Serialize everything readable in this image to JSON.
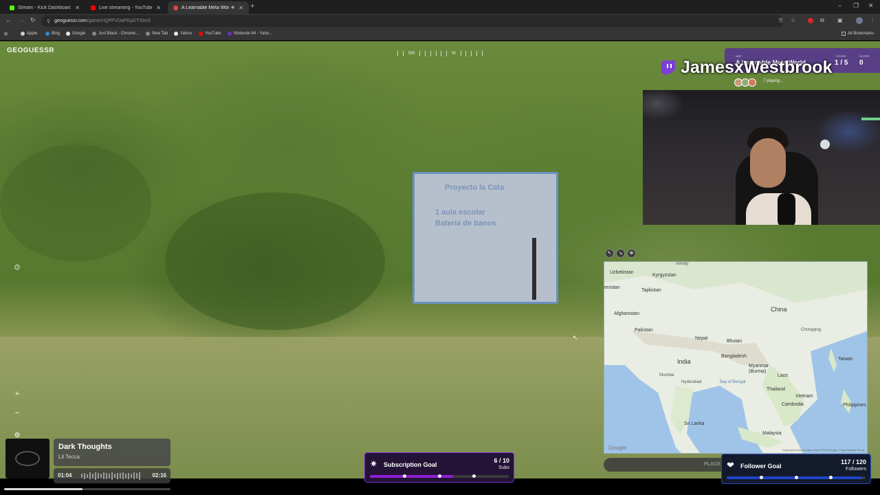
{
  "tabs": [
    {
      "label": "Stream - Kick Dashboard",
      "color": "#53fc18"
    },
    {
      "label": "Live streaming - YouTube Studi",
      "color": "#ff0000"
    },
    {
      "label": "A Learnable Meta World - F",
      "color": "#e04646"
    }
  ],
  "address": {
    "host": "geoguessr.com",
    "path": "/game/nQPFVDaPKpDTSIm3"
  },
  "bookmarks": [
    {
      "label": "Apple",
      "color": "#cccccc"
    },
    {
      "label": "Bing",
      "color": "#2a8ad4"
    },
    {
      "label": "Google",
      "color": "#e8e8e8"
    },
    {
      "label": "Just Black - Chrome...",
      "color": "#888888"
    },
    {
      "label": "New Tab",
      "color": "#888888"
    },
    {
      "label": "Yahoo",
      "color": "#e8e8e8"
    },
    {
      "label": "YouTube",
      "color": "#ff0000"
    },
    {
      "label": "Nintendo 64 - Yaho...",
      "color": "#6a2fc9"
    }
  ],
  "all_bookmarks": "All Bookmarks",
  "game": {
    "logo": "GEOGUESSR",
    "compass": {
      "left": "SW",
      "right": "W"
    },
    "map_label": "MAP",
    "map_name": "A Learnable Meta World",
    "round_label": "ROUND",
    "round_value": "1 / 5",
    "score_label": "SCORE",
    "score_value": "0",
    "sign_lines": [
      "Proyecto la Cata",
      "1 aula escolar",
      "Bateria de banos"
    ]
  },
  "streamer": {
    "name": "JamesxWestbrook",
    "playing": "7 playing..."
  },
  "minimap": {
    "labels": {
      "uzbekistan": "Uzbekistan",
      "kyrgyzstan": "Kyrgyzstan",
      "tajikistan": "Tajikistan",
      "stan": "enistan",
      "afghanistan": "Afghanistan",
      "pakistan": "Pakistan",
      "nepal": "Nepal",
      "bhutan": "Bhutan",
      "bangladesh": "Bangladesh",
      "india": "India",
      "china": "China",
      "chongqing": "Chongqing",
      "taiwan": "Taiwan",
      "myanmar": "Myanmar\n(Burma)",
      "laos": "Laos",
      "thailand": "Thailand",
      "vietnam": "Vietnam",
      "cambodia": "Cambodia",
      "philippines": "Philippines",
      "malaysia": "Malaysia",
      "srilanka": "Sri Lanka",
      "mumbai": "Mumbai",
      "hyderabad": "Hyderabad",
      "almaty": "Almaty",
      "bayofbengal": "Bay of Bengal"
    },
    "google": "Google",
    "attribution": "Keyboard shortcuts   Map Data ©2025 Google, TMap Mobility   Terms"
  },
  "place_button": "PLACE Y",
  "now_playing": {
    "title": "Dark Thoughts",
    "artist": "Lil Tecca",
    "current": "01:04",
    "total": "02:16",
    "progress": 0.47
  },
  "subscription_goal": {
    "title": "Subscription Goal",
    "count": "6 / 10",
    "unit": "Subs",
    "current": 6,
    "target": 10,
    "color": "#8f1fd6"
  },
  "follower_goal": {
    "title": "Follower Goal",
    "count": "117 / 120",
    "unit": "Followers",
    "current": 117,
    "target": 120,
    "color": "#1e44c8"
  }
}
